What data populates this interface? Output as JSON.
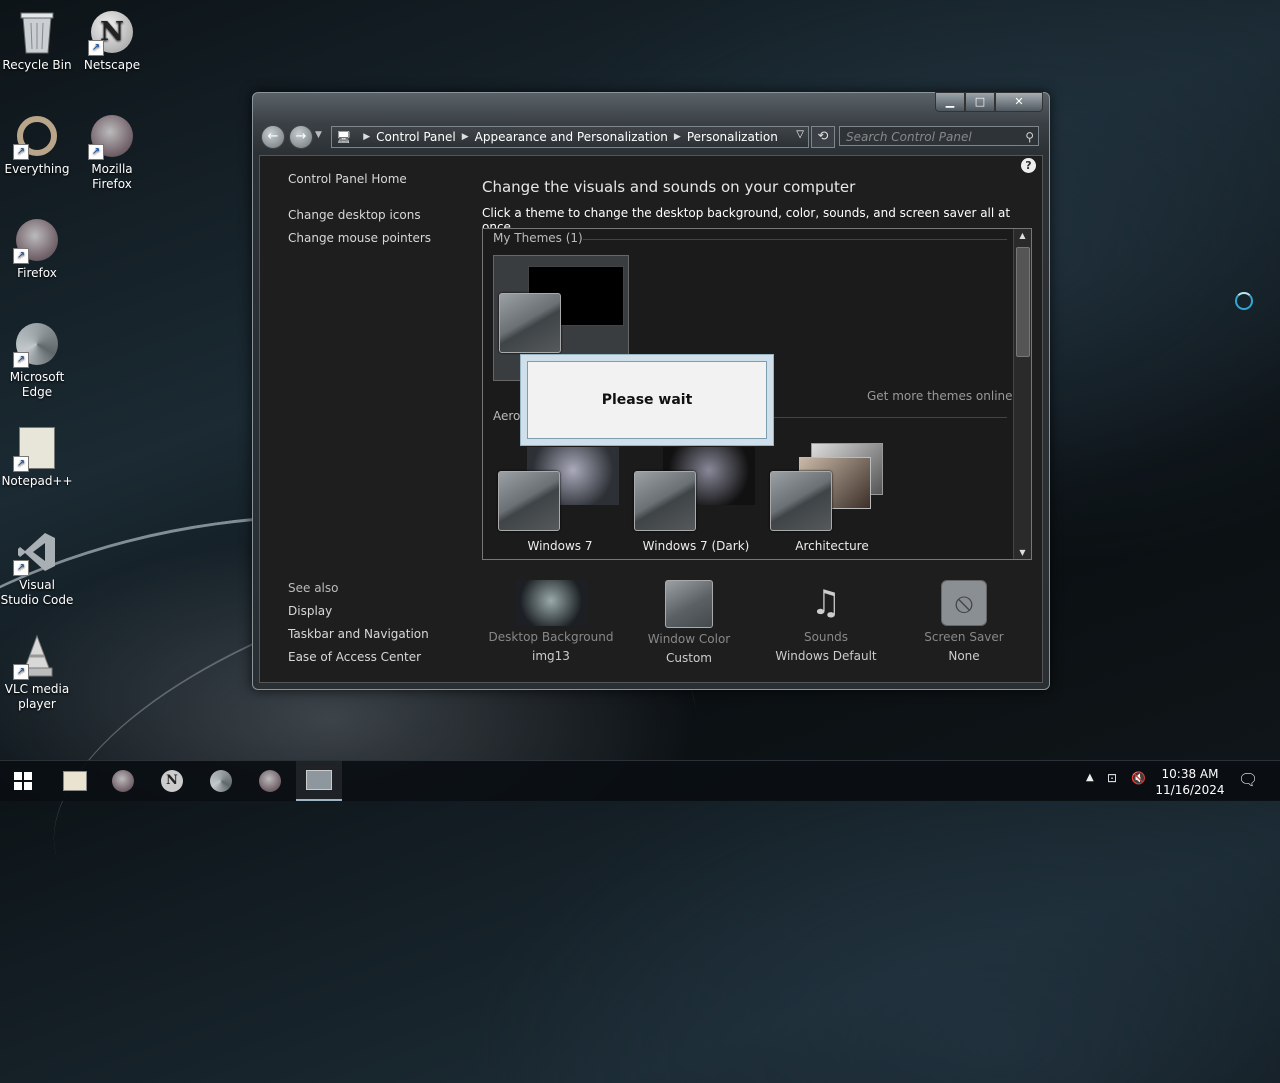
{
  "desktop": {
    "icons": [
      {
        "label": "Recycle Bin",
        "icon": "recycle-bin-icon"
      },
      {
        "label": "Netscape",
        "icon": "netscape-icon"
      },
      {
        "label": "Everything",
        "icon": "everything-icon"
      },
      {
        "label": "Mozilla Firefox",
        "icon": "firefox-icon"
      },
      {
        "label": "Firefox",
        "icon": "firefox-icon"
      },
      {
        "label": "Microsoft Edge",
        "icon": "edge-icon"
      },
      {
        "label": "Notepad++",
        "icon": "notepadpp-icon"
      },
      {
        "label": "Visual Studio Code",
        "icon": "vscode-icon"
      },
      {
        "label": "VLC media player",
        "icon": "vlc-icon"
      }
    ]
  },
  "window": {
    "breadcrumb": [
      "Control Panel",
      "Appearance and Personalization",
      "Personalization"
    ],
    "search_placeholder": "Search Control Panel",
    "left_pane": {
      "home": "Control Panel Home",
      "links": [
        "Change desktop icons",
        "Change mouse pointers"
      ],
      "see_also_heading": "See also",
      "see_also": [
        "Display",
        "Taskbar and Navigation",
        "Ease of Access Center"
      ]
    },
    "main": {
      "title": "Change the visuals and sounds on your computer",
      "subtitle": "Click a theme to change the desktop background, color, sounds, and screen saver all at once.",
      "my_themes_header": "My Themes (1)",
      "aero_header": "Aero",
      "get_more": "Get more themes online",
      "themes": [
        {
          "name": "Windows 7"
        },
        {
          "name": "Windows 7 (Dark)"
        },
        {
          "name": "Architecture"
        }
      ]
    },
    "bottom": [
      {
        "label": "Desktop Background",
        "value": "img13"
      },
      {
        "label": "Window Color",
        "value": "Custom"
      },
      {
        "label": "Sounds",
        "value": "Windows Default"
      },
      {
        "label": "Screen Saver",
        "value": "None"
      }
    ],
    "dialog": {
      "text": "Please wait"
    }
  },
  "taskbar": {
    "time": "10:38 AM",
    "date": "11/16/2024"
  },
  "colors": {
    "window_frame": "#3a4045",
    "content_bg": "#1e1e1e",
    "dialog_border": "#cfe0ea",
    "taskbar_bg": "#0a0e12"
  }
}
